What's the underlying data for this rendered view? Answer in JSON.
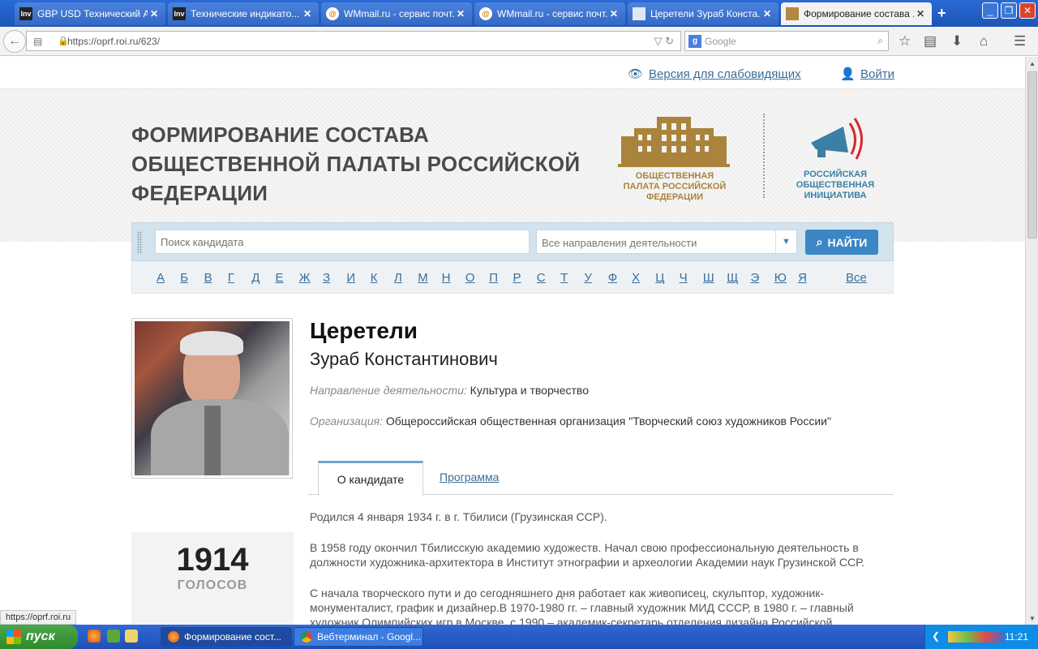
{
  "browser": {
    "tabs": [
      {
        "icon": "Inv",
        "title": "GBP USD Технический А..."
      },
      {
        "icon": "Inv",
        "title": "Технические индикато..."
      },
      {
        "icon": "@",
        "title": "WMmail.ru - сервис почт..."
      },
      {
        "icon": "@",
        "title": "WMmail.ru - сервис почт..."
      },
      {
        "icon": "doc",
        "title": "Церетели Зураб Конста..."
      },
      {
        "icon": "doc",
        "title": "Формирование состава ..."
      }
    ],
    "url": "https://oprf.roi.ru/623/",
    "search_placeholder": "Google",
    "status_url": "https://oprf.roi.ru"
  },
  "header": {
    "vision_link": "Версия для слабовидящих",
    "login_link": "Войти",
    "title": "ФОРМИРОВАНИЕ СОСТАВА ОБЩЕСТВЕННОЙ ПАЛАТЫ РОССИЙСКОЙ ФЕДЕРАЦИИ",
    "logo1_caption": "ОБЩЕСТВЕННАЯ ПАЛАТА РОССИЙСКОЙ ФЕДЕРАЦИИ",
    "logo2_caption": "РОССИЙСКАЯ ОБЩЕСТВЕННАЯ ИНИЦИАТИВА"
  },
  "search": {
    "placeholder": "Поиск кандидата",
    "direction": "Все направления деятельности",
    "button": "НАЙТИ"
  },
  "alphabet": [
    "А",
    "Б",
    "В",
    "Г",
    "Д",
    "Е",
    "Ж",
    "З",
    "И",
    "К",
    "Л",
    "М",
    "Н",
    "О",
    "П",
    "Р",
    "С",
    "Т",
    "У",
    "Ф",
    "Х",
    "Ц",
    "Ч",
    "Ш",
    "Щ",
    "Э",
    "Ю",
    "Я"
  ],
  "alphabet_all": "Все",
  "candidate": {
    "surname": "Церетели",
    "given": "Зураб Константинович",
    "direction_label": "Направление деятельности:",
    "direction": "Культура и творчество",
    "org_label": "Организация:",
    "org": "Общероссийская общественная организация \"Творческий союз художников России\"",
    "votes": "1914",
    "votes_label": "ГОЛОСОВ"
  },
  "profile_tabs": {
    "about": "О кандидате",
    "program": "Программа"
  },
  "bio": {
    "p1": "Родился 4 января 1934 г. в г. Тбилиси (Грузинская ССР).",
    "p2": "В 1958 году окончил Тбилисскую академию художеств.    Начал свою профессиональную деятельность  в должности художника-архитектора  в Институт  этнографии и археологии Академии наук Грузинской ССР.",
    "p3": "С начала творческого пути и до сегодняшнего дня работает как живописец, скульптор, художник-монументалист, график и дизайнер.В 1970-1980 гг. – главный художник МИД СССР, в 1980 г. – главный художник Олимпийских игр в Москве, с 1990 – академик-секретарь отделения дизайна Российской"
  },
  "taskbar": {
    "start": "пуск",
    "items": [
      "Формирование сост...",
      "Вебтерминал - Googl..."
    ],
    "clock": "11:21"
  }
}
